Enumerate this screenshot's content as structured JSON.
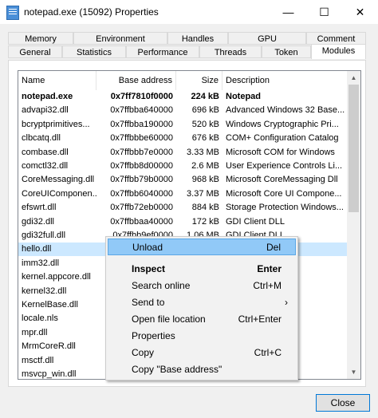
{
  "window": {
    "title": "notepad.exe (15092) Properties"
  },
  "tabs_top": [
    {
      "label": "Memory"
    },
    {
      "label": "Environment"
    },
    {
      "label": "Handles"
    },
    {
      "label": "GPU"
    },
    {
      "label": "Comment"
    }
  ],
  "tabs_bottom": [
    {
      "label": "General"
    },
    {
      "label": "Statistics"
    },
    {
      "label": "Performance"
    },
    {
      "label": "Threads"
    },
    {
      "label": "Token"
    },
    {
      "label": "Modules"
    }
  ],
  "table": {
    "columns": [
      "Name",
      "Base address",
      "Size",
      "Description"
    ],
    "rows": [
      {
        "name": "notepad.exe",
        "base": "0x7ff7810f0000",
        "size": "224 kB",
        "desc": "Notepad"
      },
      {
        "name": "advapi32.dll",
        "base": "0x7ffbba640000",
        "size": "696 kB",
        "desc": "Advanced Windows 32 Base..."
      },
      {
        "name": "bcryptprimitives...",
        "base": "0x7ffbba190000",
        "size": "520 kB",
        "desc": "Windows Cryptographic Pri..."
      },
      {
        "name": "clbcatq.dll",
        "base": "0x7ffbbbe60000",
        "size": "676 kB",
        "desc": "COM+ Configuration Catalog"
      },
      {
        "name": "combase.dll",
        "base": "0x7ffbbb7e0000",
        "size": "3.33 MB",
        "desc": "Microsoft COM for Windows"
      },
      {
        "name": "comctl32.dll",
        "base": "0x7ffbb8d00000",
        "size": "2.6 MB",
        "desc": "User Experience Controls Li..."
      },
      {
        "name": "CoreMessaging.dll",
        "base": "0x7ffbb79b0000",
        "size": "968 kB",
        "desc": "Microsoft CoreMessaging Dll"
      },
      {
        "name": "CoreUIComponen...",
        "base": "0x7ffbb6040000",
        "size": "3.37 MB",
        "desc": "Microsoft Core UI Compone..."
      },
      {
        "name": "efswrt.dll",
        "base": "0x7ffb72eb0000",
        "size": "884 kB",
        "desc": "Storage Protection Windows..."
      },
      {
        "name": "gdi32.dll",
        "base": "0x7ffbbaa40000",
        "size": "172 kB",
        "desc": "GDI Client DLL"
      },
      {
        "name": "gdi32full.dll",
        "base": "0x7ffbb9ef0000",
        "size": "1.06 MB",
        "desc": "GDI Client DLL"
      },
      {
        "name": "hello.dll",
        "base": "",
        "size": "",
        "desc": ""
      },
      {
        "name": "imm32.dll",
        "base": "",
        "size": "",
        "desc": "IMM32"
      },
      {
        "name": "kernel.appcore.dll",
        "base": "",
        "size": "",
        "desc": ""
      },
      {
        "name": "kernel32.dll",
        "base": "",
        "size": "",
        "desc": "API Client..."
      },
      {
        "name": "KernelBase.dll",
        "base": "",
        "size": "",
        "desc": "API Clien..."
      },
      {
        "name": "locale.nls",
        "base": "",
        "size": "",
        "desc": ""
      },
      {
        "name": "mpr.dll",
        "base": "",
        "size": "",
        "desc": "outer DLL"
      },
      {
        "name": "MrmCoreR.dll",
        "base": "",
        "size": "",
        "desc": "MRM"
      },
      {
        "name": "msctf.dll",
        "base": "",
        "size": "",
        "desc": ""
      },
      {
        "name": "msvcp_win.dll",
        "base": "",
        "size": "",
        "desc": "me Library"
      },
      {
        "name": "msvcrt.dll",
        "base": "",
        "size": "",
        "desc": ""
      }
    ]
  },
  "context_menu": [
    {
      "label": "Unload",
      "shortcut": "Del"
    },
    {
      "label": "Inspect",
      "shortcut": "Enter"
    },
    {
      "label": "Search online",
      "shortcut": "Ctrl+M"
    },
    {
      "label": "Send to",
      "shortcut": "›"
    },
    {
      "label": "Open file location",
      "shortcut": "Ctrl+Enter"
    },
    {
      "label": "Properties",
      "shortcut": ""
    },
    {
      "label": "Copy",
      "shortcut": "Ctrl+C"
    },
    {
      "label": "Copy \"Base address\"",
      "shortcut": ""
    }
  ],
  "buttons": {
    "close": "Close"
  },
  "icons": {
    "app": "notepad-icon",
    "minimize": "minimize-icon",
    "maximize": "maximize-icon",
    "close": "close-icon",
    "submenu": "chevron-right-icon"
  },
  "colors": {
    "selection": "#cce8ff",
    "menu_hover": "#91c9f7",
    "accent": "#0078d7"
  }
}
